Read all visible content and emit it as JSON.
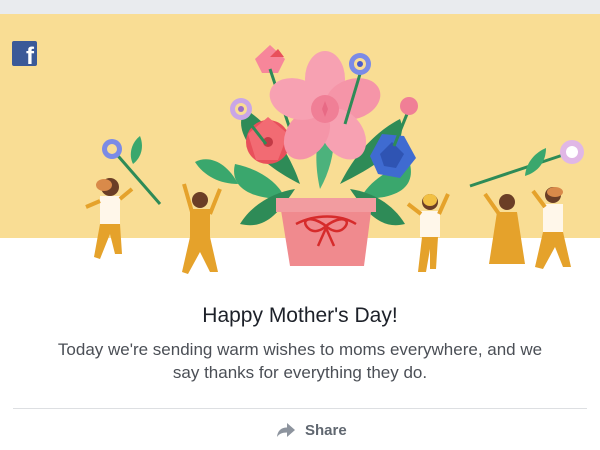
{
  "brand": {
    "logo_letter": "f",
    "logo_color": "#3b5998"
  },
  "banner": {
    "background_color": "#f9dd94",
    "icons": [
      "flower-pot-illustration",
      "dancing-people-illustration"
    ]
  },
  "card": {
    "title": "Happy Mother's Day!",
    "message": "Today we're sending warm wishes to moms everywhere, and we say thanks for everything they do."
  },
  "actions": {
    "share_label": "Share",
    "share_icon": "share-arrow-icon"
  }
}
